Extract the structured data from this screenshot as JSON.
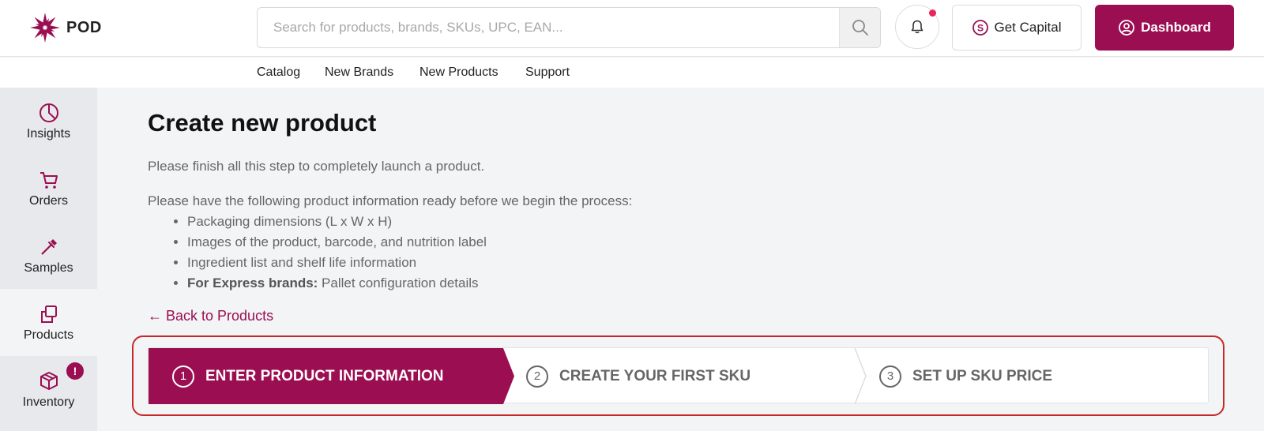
{
  "header": {
    "logo_text": "POD",
    "search_placeholder": "Search for products, brands, SKUs, UPC, EAN...",
    "get_capital_label": "Get Capital",
    "dashboard_label": "Dashboard",
    "brand_color": "#9b0e52",
    "notification_dot_color": "#e8245a"
  },
  "subnav": {
    "items": [
      "Catalog",
      "New Brands",
      "New Products",
      "Support"
    ]
  },
  "sidebar": {
    "items": [
      {
        "label": "Insights",
        "icon": "pie-chart-icon"
      },
      {
        "label": "Orders",
        "icon": "cart-icon"
      },
      {
        "label": "Samples",
        "icon": "dropper-icon"
      },
      {
        "label": "Products",
        "icon": "copy-icon",
        "active": true
      },
      {
        "label": "Inventory",
        "icon": "box-icon",
        "badge": "!"
      }
    ]
  },
  "main": {
    "title": "Create new product",
    "intro": "Please finish all this step to completely launch a product.",
    "prep_text": "Please have the following product information ready before we begin the process:",
    "requirements": [
      "Packaging dimensions (L x W x H)",
      "Images of the product, barcode, and nutrition label",
      "Ingredient list and shelf life information"
    ],
    "express_bold": "For Express brands:",
    "express_text": " Pallet configuration details",
    "back_link": "← Back to Products"
  },
  "stepper": {
    "steps": [
      {
        "num": "1",
        "label": "ENTER PRODUCT INFORMATION",
        "active": true
      },
      {
        "num": "2",
        "label": "CREATE YOUR FIRST SKU",
        "active": false
      },
      {
        "num": "3",
        "label": "SET UP SKU PRICE",
        "active": false
      }
    ],
    "highlight_color": "#c62828"
  }
}
